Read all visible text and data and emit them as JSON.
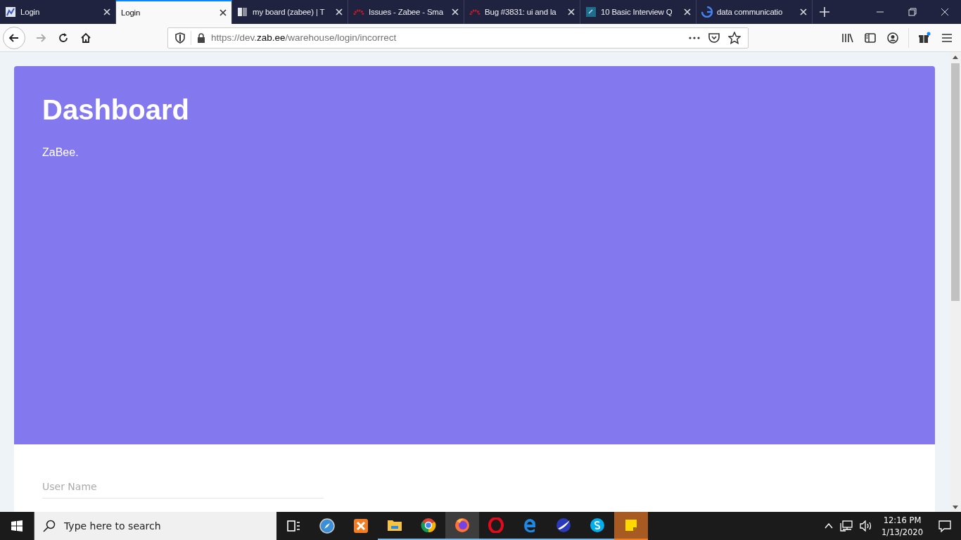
{
  "browser": {
    "tabs": [
      {
        "title": "Login",
        "selected": false
      },
      {
        "title": "Login",
        "selected": true
      },
      {
        "title": "my board (zabee) | T",
        "selected": false
      },
      {
        "title": "Issues - Zabee - Sma",
        "selected": false
      },
      {
        "title": "Bug #3831: ui and la",
        "selected": false
      },
      {
        "title": "10 Basic Interview Q",
        "selected": false
      },
      {
        "title": "data communicatio",
        "selected": false
      }
    ],
    "url": {
      "prefix": "https://dev.",
      "domain": "zab.ee",
      "path": "/warehouse/login/incorrect"
    }
  },
  "page": {
    "header": {
      "title": "Dashboard",
      "subtitle": "ZaBee."
    },
    "form": {
      "username": {
        "placeholder": "User Name"
      }
    }
  },
  "taskbar": {
    "search": {
      "placeholder": "Type here to search"
    },
    "apps": [
      {
        "running": false,
        "active": false
      },
      {
        "running": false,
        "active": false
      },
      {
        "running": false,
        "active": false
      },
      {
        "running": true,
        "active": false
      },
      {
        "running": true,
        "active": false
      },
      {
        "running": true,
        "active": true
      },
      {
        "running": true,
        "active": false
      },
      {
        "running": true,
        "active": false
      },
      {
        "running": true,
        "active": false
      },
      {
        "running": true,
        "active": false
      },
      {
        "running": true,
        "active": true
      }
    ],
    "time": "12:16 PM",
    "date": "1/13/2020"
  }
}
